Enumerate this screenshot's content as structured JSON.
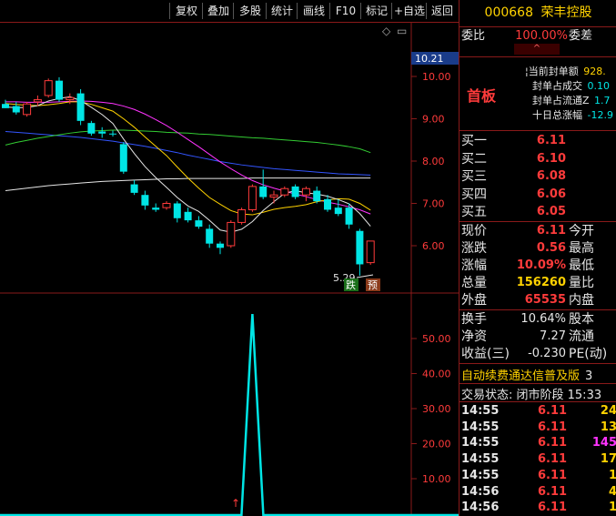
{
  "toolbar": {
    "buttons": [
      "复权",
      "叠加",
      "多股",
      "统计",
      "画线",
      "F10",
      "标记",
      "+自选",
      "返回"
    ]
  },
  "chart": {
    "price_axis": [
      "10.00",
      "9.00",
      "8.00",
      "7.00",
      "6.00"
    ],
    "current_price_label": "10.21",
    "low_label": "5.29",
    "markers": [
      "跌",
      "预"
    ],
    "ind_axis": [
      "50.00",
      "40.00",
      "30.00",
      "20.00",
      "10.00"
    ],
    "colors": {
      "up": "#ff3b3b",
      "down": "#00e5e5",
      "ma5": "#e6e6e6",
      "ma10": "#ffd200",
      "ma20": "#ff33ff",
      "ma60": "#33cc33",
      "ma120": "#3355ff"
    }
  },
  "chart_data": {
    "type": "candlestick",
    "ylim": [
      5.2,
      10.4
    ],
    "candles": [
      {
        "o": 9.35,
        "h": 9.45,
        "l": 9.25,
        "c": 9.25
      },
      {
        "o": 9.3,
        "h": 9.4,
        "l": 9.1,
        "c": 9.15
      },
      {
        "o": 9.1,
        "h": 9.4,
        "l": 9.05,
        "c": 9.35
      },
      {
        "o": 9.4,
        "h": 9.55,
        "l": 9.3,
        "c": 9.45
      },
      {
        "o": 9.55,
        "h": 9.95,
        "l": 9.5,
        "c": 9.9
      },
      {
        "o": 9.9,
        "h": 9.98,
        "l": 9.4,
        "c": 9.45
      },
      {
        "o": 9.45,
        "h": 9.6,
        "l": 9.35,
        "c": 9.5
      },
      {
        "o": 9.6,
        "h": 9.7,
        "l": 8.85,
        "c": 8.95
      },
      {
        "o": 8.9,
        "h": 8.95,
        "l": 8.6,
        "c": 8.65
      },
      {
        "o": 8.7,
        "h": 8.8,
        "l": 8.55,
        "c": 8.65
      },
      {
        "o": 8.65,
        "h": 8.72,
        "l": 8.58,
        "c": 8.63
      },
      {
        "o": 8.4,
        "h": 8.45,
        "l": 7.7,
        "c": 7.75
      },
      {
        "o": 7.45,
        "h": 7.55,
        "l": 7.2,
        "c": 7.25
      },
      {
        "o": 7.2,
        "h": 7.3,
        "l": 6.85,
        "c": 6.95
      },
      {
        "o": 6.9,
        "h": 7.0,
        "l": 6.8,
        "c": 6.85
      },
      {
        "o": 6.9,
        "h": 7.05,
        "l": 6.85,
        "c": 7.0
      },
      {
        "o": 7.0,
        "h": 7.05,
        "l": 6.55,
        "c": 6.65
      },
      {
        "o": 6.8,
        "h": 6.9,
        "l": 6.55,
        "c": 6.6
      },
      {
        "o": 6.6,
        "h": 6.7,
        "l": 6.4,
        "c": 6.45
      },
      {
        "o": 6.4,
        "h": 6.5,
        "l": 5.95,
        "c": 6.05
      },
      {
        "o": 6.05,
        "h": 6.1,
        "l": 5.8,
        "c": 5.95
      },
      {
        "o": 6.0,
        "h": 6.6,
        "l": 5.95,
        "c": 6.55
      },
      {
        "o": 6.55,
        "h": 6.9,
        "l": 6.5,
        "c": 6.85
      },
      {
        "o": 6.85,
        "h": 7.45,
        "l": 6.8,
        "c": 7.4
      },
      {
        "o": 7.4,
        "h": 7.8,
        "l": 7.1,
        "c": 7.15
      },
      {
        "o": 7.15,
        "h": 7.3,
        "l": 7.0,
        "c": 7.2
      },
      {
        "o": 7.2,
        "h": 7.4,
        "l": 7.15,
        "c": 7.35
      },
      {
        "o": 7.4,
        "h": 7.45,
        "l": 7.1,
        "c": 7.15
      },
      {
        "o": 7.2,
        "h": 7.4,
        "l": 7.05,
        "c": 7.35
      },
      {
        "o": 7.3,
        "h": 7.4,
        "l": 7.0,
        "c": 7.05
      },
      {
        "o": 7.1,
        "h": 7.2,
        "l": 6.8,
        "c": 6.85
      },
      {
        "o": 6.9,
        "h": 7.1,
        "l": 6.7,
        "c": 6.75
      },
      {
        "o": 6.9,
        "h": 7.0,
        "l": 6.4,
        "c": 6.5
      },
      {
        "o": 6.35,
        "h": 6.4,
        "l": 5.29,
        "c": 5.56
      },
      {
        "o": 5.6,
        "h": 6.11,
        "l": 5.55,
        "c": 6.11
      }
    ],
    "ma5": [
      9.28,
      9.26,
      9.27,
      9.31,
      9.42,
      9.48,
      9.52,
      9.43,
      9.27,
      9.1,
      8.89,
      8.52,
      8.18,
      7.87,
      7.61,
      7.38,
      7.14,
      6.94,
      6.81,
      6.6,
      6.37,
      6.32,
      6.39,
      6.57,
      6.83,
      7.04,
      7.24,
      7.3,
      7.25,
      7.22,
      7.17,
      7.09,
      6.99,
      6.76,
      6.46
    ],
    "ma10": [
      9.36,
      9.34,
      9.32,
      9.31,
      9.33,
      9.36,
      9.4,
      9.4,
      9.34,
      9.26,
      9.18,
      9.0,
      8.8,
      8.57,
      8.35,
      8.13,
      7.86,
      7.6,
      7.36,
      7.14,
      6.98,
      6.83,
      6.75,
      6.73,
      6.79,
      6.86,
      6.9,
      6.93,
      6.97,
      7.04,
      7.08,
      7.11,
      7.1,
      7.0,
      6.84
    ],
    "ma20": [
      9.4,
      9.4,
      9.39,
      9.39,
      9.39,
      9.4,
      9.41,
      9.42,
      9.41,
      9.39,
      9.36,
      9.3,
      9.22,
      9.11,
      8.98,
      8.84,
      8.68,
      8.51,
      8.34,
      8.16,
      7.98,
      7.82,
      7.67,
      7.54,
      7.44,
      7.36,
      7.29,
      7.22,
      7.16,
      7.09,
      7.03,
      6.98,
      6.92,
      6.85,
      6.75
    ],
    "ma60": [
      8.38,
      8.44,
      8.49,
      8.54,
      8.58,
      8.62,
      8.66,
      8.69,
      8.71,
      8.72,
      8.73,
      8.73,
      8.72,
      8.71,
      8.7,
      8.68,
      8.67,
      8.66,
      8.64,
      8.63,
      8.61,
      8.59,
      8.57,
      8.55,
      8.54,
      8.52,
      8.5,
      8.48,
      8.46,
      8.44,
      8.41,
      8.38,
      8.34,
      8.29,
      8.2
    ],
    "ma120": [
      8.7,
      8.68,
      8.66,
      8.64,
      8.62,
      8.6,
      8.58,
      8.56,
      8.53,
      8.5,
      8.47,
      8.43,
      8.39,
      8.35,
      8.3,
      8.25,
      8.2,
      8.14,
      8.09,
      8.04,
      7.99,
      7.95,
      7.91,
      7.88,
      7.85,
      7.82,
      7.8,
      7.78,
      7.76,
      7.74,
      7.72,
      7.7,
      7.69,
      7.68,
      7.67
    ],
    "ma250": [
      7.3,
      7.33,
      7.36,
      7.39,
      7.42,
      7.44,
      7.46,
      7.48,
      7.5,
      7.52,
      7.53,
      7.54,
      7.55,
      7.56,
      7.57,
      7.58,
      7.58,
      7.59,
      7.59,
      7.59,
      7.59,
      7.59,
      7.59,
      7.6,
      7.6,
      7.6,
      7.6,
      7.6,
      7.6,
      7.6,
      7.6,
      7.6,
      7.6,
      7.6,
      7.6
    ],
    "indicator": {
      "ylim": [
        0,
        60
      ],
      "values": [
        0,
        0,
        0,
        0,
        0,
        0,
        0,
        0,
        0,
        0,
        0,
        0,
        0,
        0,
        0,
        0,
        0,
        0,
        0,
        0,
        0,
        0,
        0,
        0,
        0,
        0,
        0,
        0,
        0,
        0,
        0,
        0,
        0,
        0,
        0
      ],
      "spike": {
        "index": 23,
        "value": 57
      }
    }
  },
  "quote": {
    "code": "000668",
    "name": "荣丰控股",
    "weibi_label": "委比",
    "weibi_value": "100.00%",
    "weicha_label": "委差",
    "limit_up": "首板",
    "seal_lines": [
      {
        "label": "当前封单额",
        "value": "928."
      },
      {
        "label": "封单占成交",
        "value": "0.10"
      },
      {
        "label": "封单占流通Z",
        "value": "1.7"
      },
      {
        "label": "十日总涨幅",
        "value": "-12.9"
      }
    ],
    "bids": [
      {
        "label": "买一",
        "value": "6.11"
      },
      {
        "label": "买二",
        "value": "6.10"
      },
      {
        "label": "买三",
        "value": "6.08"
      },
      {
        "label": "买四",
        "value": "6.06"
      },
      {
        "label": "买五",
        "value": "6.05"
      }
    ],
    "stats": [
      {
        "l1": "现价",
        "v": "6.11",
        "l2": "今开",
        "cls": "red"
      },
      {
        "l1": "涨跌",
        "v": "0.56",
        "l2": "最高",
        "cls": "red"
      },
      {
        "l1": "涨幅",
        "v": "10.09%",
        "l2": "最低",
        "cls": "red"
      },
      {
        "l1": "总量",
        "v": "156260",
        "l2": "量比",
        "cls": "yel"
      },
      {
        "l1": "外盘",
        "v": "65535",
        "l2": "内盘",
        "cls": "red"
      }
    ],
    "stats2": [
      {
        "l1": "换手",
        "v": "10.64%",
        "l2": "股本"
      },
      {
        "l1": "净资",
        "v": "7.27",
        "l2": "流通"
      },
      {
        "l1": "收益(三)",
        "v": "-0.230",
        "l2": "PE(动)"
      }
    ],
    "banner": "自动续费通达信普及版",
    "banner_tail": "3",
    "trade_status": "交易状态: 闭市阶段 15:33",
    "ticks": [
      {
        "t": "14:55",
        "p": "6.11",
        "v": "24",
        "c": "#ffd200"
      },
      {
        "t": "14:55",
        "p": "6.11",
        "v": "13",
        "c": "#ffd200"
      },
      {
        "t": "14:55",
        "p": "6.11",
        "v": "145",
        "c": "#ff33ff"
      },
      {
        "t": "14:55",
        "p": "6.11",
        "v": "17",
        "c": "#ffd200"
      },
      {
        "t": "14:55",
        "p": "6.11",
        "v": "1",
        "c": "#ffd200"
      },
      {
        "t": "14:56",
        "p": "6.11",
        "v": "4",
        "c": "#ffd200"
      },
      {
        "t": "14:56",
        "p": "6.11",
        "v": "1",
        "c": "#ffd200"
      }
    ]
  }
}
